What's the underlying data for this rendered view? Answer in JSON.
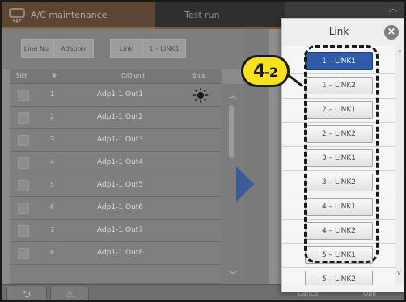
{
  "title_bar": {
    "maintenance_tab": "A/C maintenance",
    "testrun_tab": "Test run"
  },
  "filters": {
    "line_no": "Line No.",
    "adapter": "Adapter",
    "link": "Link",
    "link_value": "1 – LINK1"
  },
  "table": {
    "headers": {
      "slct": "Slct",
      "num": "#",
      "unit": "O/D unit",
      "stus": "Stus"
    },
    "rows": [
      {
        "num": "1",
        "unit": "Adp1-1 Out1",
        "status_icon": "sun-icon"
      },
      {
        "num": "2",
        "unit": "Adp1-1 Out2",
        "status_icon": ""
      },
      {
        "num": "3",
        "unit": "Adp1-1 Out3",
        "status_icon": ""
      },
      {
        "num": "4",
        "unit": "Adp1-1 Out4",
        "status_icon": ""
      },
      {
        "num": "5",
        "unit": "Adp1-1 Out5",
        "status_icon": ""
      },
      {
        "num": "6",
        "unit": "Adp1-1 Out6",
        "status_icon": ""
      },
      {
        "num": "7",
        "unit": "Adp1-1 Out7",
        "status_icon": ""
      },
      {
        "num": "8",
        "unit": "Adp1-1 Out8",
        "status_icon": ""
      }
    ]
  },
  "link_popup": {
    "title": "Link",
    "items": [
      "1 – LINK1",
      "1 – LINK2",
      "2 – LINK1",
      "2 – LINK2",
      "3 – LINK1",
      "3 – LINK2",
      "4 – LINK1",
      "4 – LINK2",
      "5 – LINK1",
      "5 – LINK2"
    ],
    "selected_index": 0
  },
  "callout": {
    "main": "4",
    "sub": "-2"
  },
  "bottom": {
    "back": "⮌",
    "warning": "⚠",
    "cancel": "Cancel",
    "ope": "Ope"
  },
  "colors": {
    "selected_item": "#2f5aa8",
    "callout_fill": "#f7e21a",
    "arrow": "#3a5a9a"
  }
}
